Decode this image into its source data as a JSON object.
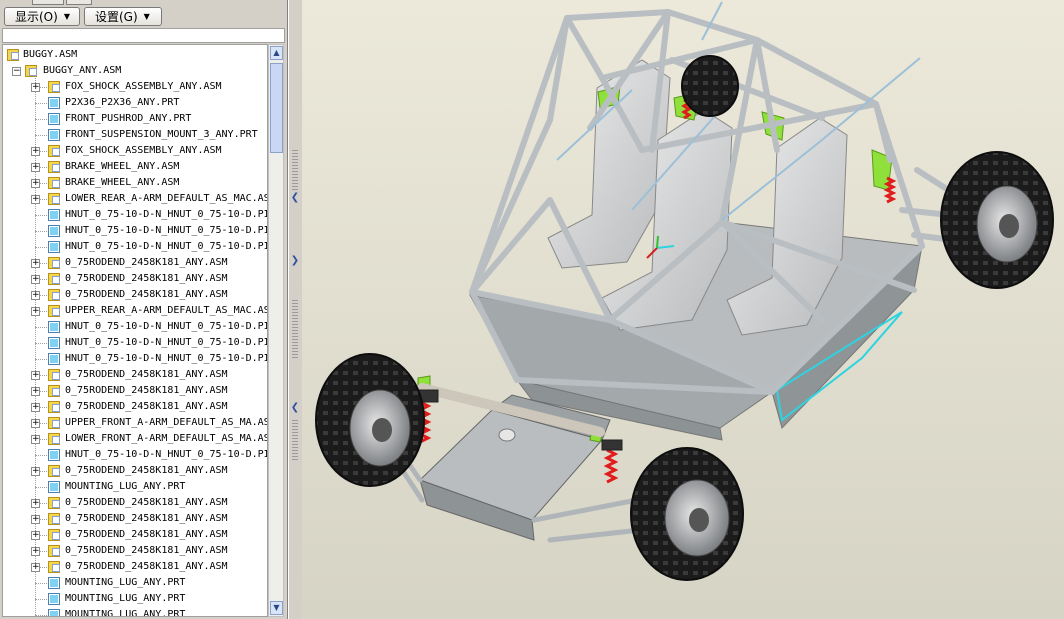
{
  "toolbar": {
    "display_label": "显示(O)",
    "settings_label": "设置(G)"
  },
  "tree": {
    "root": "BUGGY.ASM",
    "subassembly": "BUGGY_ANY.ASM",
    "items": [
      {
        "label": "FOX_SHOCK_ASSEMBLY_ANY.ASM",
        "type": "asm",
        "expandable": true
      },
      {
        "label": "P2X36_P2X36_ANY.PRT",
        "type": "prt",
        "expandable": false
      },
      {
        "label": "FRONT_PUSHROD_ANY.PRT",
        "type": "prt",
        "expandable": false
      },
      {
        "label": "FRONT_SUSPENSION_MOUNT_3_ANY.PRT",
        "type": "prt",
        "expandable": false
      },
      {
        "label": "FOX_SHOCK_ASSEMBLY_ANY.ASM",
        "type": "asm",
        "expandable": true
      },
      {
        "label": "BRAKE_WHEEL_ANY.ASM",
        "type": "asm",
        "expandable": true
      },
      {
        "label": "BRAKE_WHEEL_ANY.ASM",
        "type": "asm",
        "expandable": true
      },
      {
        "label": "LOWER_REAR_A-ARM_DEFAULT_AS_MAC.AS",
        "type": "asm",
        "expandable": true
      },
      {
        "label": "HNUT_0_75-10-D-N_HNUT_0_75-10-D.PI",
        "type": "prt",
        "expandable": false
      },
      {
        "label": "HNUT_0_75-10-D-N_HNUT_0_75-10-D.PI",
        "type": "prt",
        "expandable": false
      },
      {
        "label": "HNUT_0_75-10-D-N_HNUT_0_75-10-D.PI",
        "type": "prt",
        "expandable": false
      },
      {
        "label": "0_75RODEND_2458K181_ANY.ASM",
        "type": "asm",
        "expandable": true
      },
      {
        "label": "0_75RODEND_2458K181_ANY.ASM",
        "type": "asm",
        "expandable": true
      },
      {
        "label": "0_75RODEND_2458K181_ANY.ASM",
        "type": "asm",
        "expandable": true
      },
      {
        "label": "UPPER_REAR_A-ARM_DEFAULT_AS_MAC.AS",
        "type": "asm",
        "expandable": true
      },
      {
        "label": "HNUT_0_75-10-D-N_HNUT_0_75-10-D.PI",
        "type": "prt",
        "expandable": false
      },
      {
        "label": "HNUT_0_75-10-D-N_HNUT_0_75-10-D.PI",
        "type": "prt",
        "expandable": false
      },
      {
        "label": "HNUT_0_75-10-D-N_HNUT_0_75-10-D.PI",
        "type": "prt",
        "expandable": false
      },
      {
        "label": "0_75RODEND_2458K181_ANY.ASM",
        "type": "asm",
        "expandable": true
      },
      {
        "label": "0_75RODEND_2458K181_ANY.ASM",
        "type": "asm",
        "expandable": true
      },
      {
        "label": "0_75RODEND_2458K181_ANY.ASM",
        "type": "asm",
        "expandable": true
      },
      {
        "label": "UPPER_FRONT_A-ARM_DEFAULT_AS_MA.AS",
        "type": "asm",
        "expandable": true
      },
      {
        "label": "LOWER_FRONT_A-ARM_DEFAULT_AS_MA.AS",
        "type": "asm",
        "expandable": true
      },
      {
        "label": "HNUT_0_75-10-D-N_HNUT_0_75-10-D.PI",
        "type": "prt",
        "expandable": false
      },
      {
        "label": "0_75RODEND_2458K181_ANY.ASM",
        "type": "asm",
        "expandable": true
      },
      {
        "label": "MOUNTING_LUG_ANY.PRT",
        "type": "prt",
        "expandable": false
      },
      {
        "label": "0_75RODEND_2458K181_ANY.ASM",
        "type": "asm",
        "expandable": true
      },
      {
        "label": "0_75RODEND_2458K181_ANY.ASM",
        "type": "asm",
        "expandable": true
      },
      {
        "label": "0_75RODEND_2458K181_ANY.ASM",
        "type": "asm",
        "expandable": true
      },
      {
        "label": "0_75RODEND_2458K181_ANY.ASM",
        "type": "asm",
        "expandable": true
      },
      {
        "label": "0_75RODEND_2458K181_ANY.ASM",
        "type": "asm",
        "expandable": true
      },
      {
        "label": "MOUNTING_LUG_ANY.PRT",
        "type": "prt",
        "expandable": false
      },
      {
        "label": "MOUNTING_LUG_ANY.PRT",
        "type": "prt",
        "expandable": false
      },
      {
        "label": "MOUNTING_LUG_ANY.PRT",
        "type": "prt",
        "expandable": false
      }
    ]
  },
  "icons": {
    "asm": "assembly-icon",
    "prt": "part-icon",
    "expand": "expand-plus-icon",
    "collapse": "collapse-minus-icon"
  },
  "colors": {
    "panel_bg": "#d4d0c8",
    "tree_bg": "#ffffff",
    "viewport_top": "#ece9da",
    "viewport_bottom": "#d6d4c4",
    "frame_tube": "#b9bec3",
    "panel_steel": "#9ea3a6",
    "seat": "#d9dadb",
    "tire": "#1e1e1e",
    "spring": "#e01c1c",
    "bracket_green": "#8fe03a",
    "highlight_edge": "#2ed3e0"
  }
}
